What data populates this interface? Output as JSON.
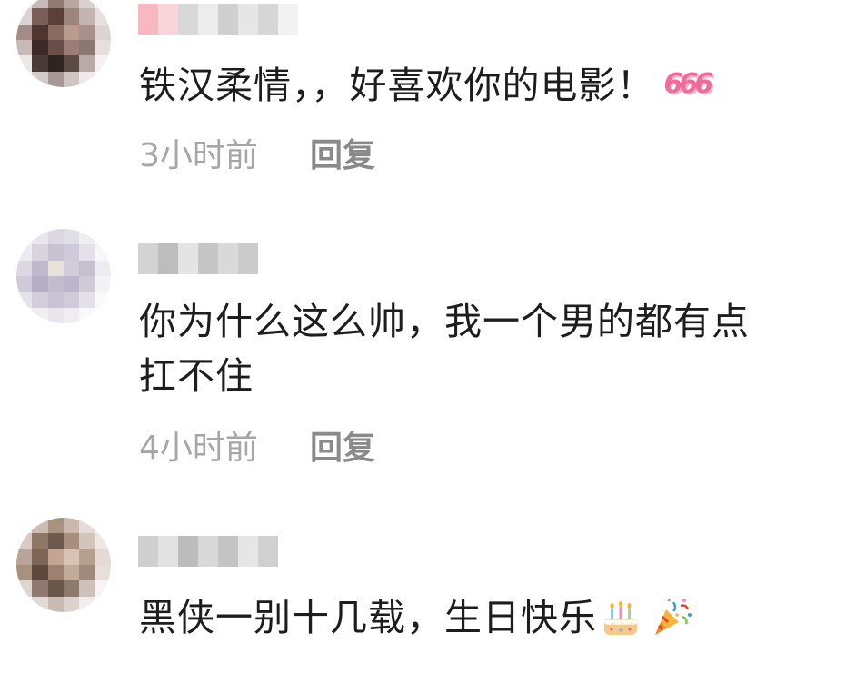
{
  "colors": {
    "text": "#1d1d1d",
    "meta_gray": "#a6a6a6",
    "reply_gray": "#8a8a8a",
    "sticker_pink": "#f06a9a"
  },
  "comments": [
    {
      "text": "铁汉柔情，，好喜欢你的电影！",
      "sticker": "666",
      "time": "3小时前",
      "reply": "回复",
      "icons": [
        "avatar-blurred",
        "username-blurred"
      ]
    },
    {
      "text_line1": "你为什么这么帅，我一个男的都有点",
      "text_line2": "扛不住",
      "time": "4小时前",
      "reply": "回复",
      "icons": [
        "avatar-blurred",
        "username-blurred"
      ]
    },
    {
      "text": "黑侠一别十几载，生日快乐",
      "icons": [
        "avatar-blurred",
        "username-blurred",
        "birthday-cake-icon",
        "party-popper-icon"
      ]
    }
  ]
}
